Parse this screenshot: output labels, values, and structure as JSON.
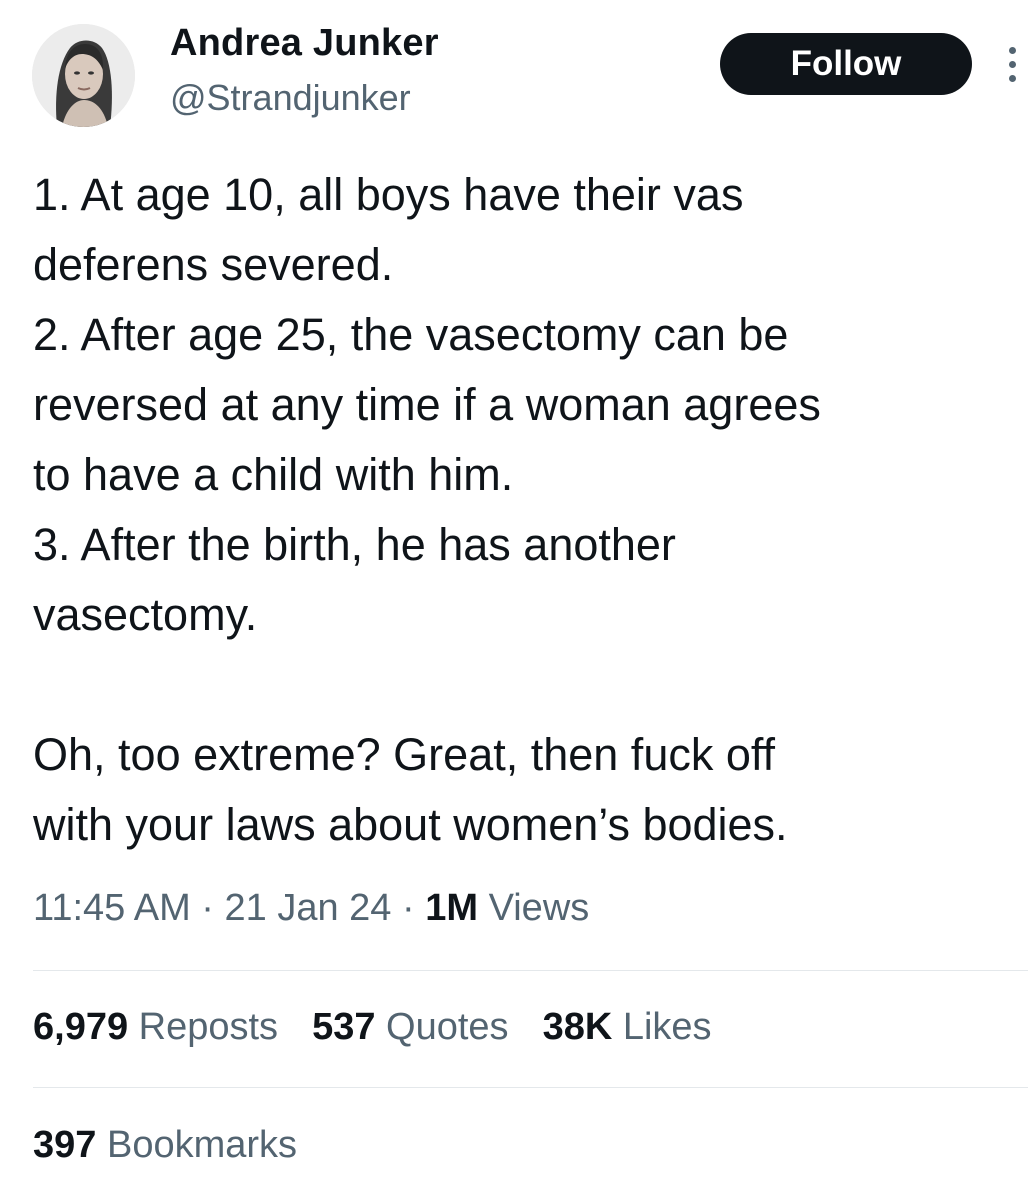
{
  "author": {
    "name": "Andrea Junker",
    "handle": "@Strandjunker"
  },
  "actions": {
    "follow_label": "Follow",
    "more_icon": "more-vertical-icon"
  },
  "tweet": {
    "lines": [
      "1. At age 10, all boys have their vas",
      "deferens severed.",
      "2. After age 25, the vasectomy can be",
      "reversed at any time if a woman agrees",
      "to have a child with him.",
      "3. After the birth, he has another",
      "vasectomy.",
      "",
      "Oh, too extreme? Great, then fuck off",
      "with your laws about women’s bodies."
    ]
  },
  "meta": {
    "time": "11:45 AM",
    "date": "21 Jan 24",
    "separator": "·",
    "views_count": "1M",
    "views_label": "Views"
  },
  "stats": {
    "reposts_count": "6,979",
    "reposts_label": "Reposts",
    "quotes_count": "537",
    "quotes_label": "Quotes",
    "likes_count": "38K",
    "likes_label": "Likes",
    "bookmarks_count": "397",
    "bookmarks_label": "Bookmarks"
  },
  "colors": {
    "text": "#0f1419",
    "secondary": "#536471",
    "button_bg": "#0f1419",
    "divider": "#e4e8eb"
  }
}
